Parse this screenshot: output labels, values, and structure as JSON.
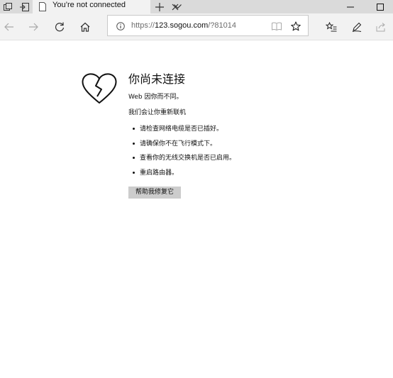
{
  "tab": {
    "title": "You’re not connected"
  },
  "address_bar": {
    "url_scheme": "https://",
    "url_host": "123.sogou.com",
    "url_path": "/?81014"
  },
  "error_page": {
    "title": "你尚未连接",
    "line1": "Web 因你而不同。",
    "line2": "我们会让你重新联机",
    "tips": [
      "请检查网络电缆是否已插好。",
      "请确保你不在飞行模式下。",
      "查看你的无线交换机是否已启用。",
      "重启路由器。"
    ],
    "fix_button_label": "帮助我修复它"
  },
  "colors": {
    "tab_bar": "#dadada",
    "toolbar": "#f2f2f2",
    "button": "#cccccc"
  }
}
